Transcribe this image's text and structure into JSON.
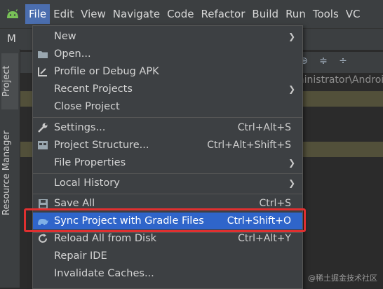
{
  "menubar": {
    "items": [
      "File",
      "Edit",
      "View",
      "Navigate",
      "Code",
      "Refactor",
      "Build",
      "Run",
      "Tools",
      "VC"
    ],
    "active_index": 0
  },
  "toolbar": {
    "project_initial": "M"
  },
  "left_stripe": {
    "project_tab": "Project",
    "resource_tab": "Resource Manager"
  },
  "background": {
    "path_fragment": "ministrator\\Androi"
  },
  "file_menu": {
    "items": [
      {
        "label": "New",
        "shortcut": "",
        "submenu": true,
        "icon": "none"
      },
      {
        "label": "Open...",
        "shortcut": "",
        "submenu": false,
        "icon": "folder-icon"
      },
      {
        "label": "Profile or Debug APK",
        "shortcut": "",
        "submenu": false,
        "icon": "profile-debug-icon"
      },
      {
        "label": "Recent Projects",
        "shortcut": "",
        "submenu": true,
        "icon": "none"
      },
      {
        "label": "Close Project",
        "shortcut": "",
        "submenu": false,
        "icon": "none"
      },
      {
        "label": "Settings...",
        "shortcut": "Ctrl+Alt+S",
        "submenu": false,
        "icon": "wrench-icon"
      },
      {
        "label": "Project Structure...",
        "shortcut": "Ctrl+Alt+Shift+S",
        "submenu": false,
        "icon": "project-structure-icon"
      },
      {
        "label": "File Properties",
        "shortcut": "",
        "submenu": true,
        "icon": "none"
      },
      {
        "label": "Local History",
        "shortcut": "",
        "submenu": true,
        "icon": "none"
      },
      {
        "label": "Save All",
        "shortcut": "Ctrl+S",
        "submenu": false,
        "icon": "save-icon"
      },
      {
        "label": "Sync Project with Gradle Files",
        "shortcut": "Ctrl+Shift+O",
        "submenu": false,
        "icon": "gradle-elephant-icon"
      },
      {
        "label": "Reload All from Disk",
        "shortcut": "Ctrl+Alt+Y",
        "submenu": false,
        "icon": "reload-icon"
      },
      {
        "label": "Repair IDE",
        "shortcut": "",
        "submenu": false,
        "icon": "none"
      },
      {
        "label": "Invalidate Caches...",
        "shortcut": "",
        "submenu": false,
        "icon": "none"
      }
    ],
    "selected_index": 10
  },
  "watermark": "@稀土掘金技术社区",
  "colors": {
    "selection": "#2f65ca",
    "highlight_frame": "#e03030",
    "menu_bg": "#3d4043"
  }
}
